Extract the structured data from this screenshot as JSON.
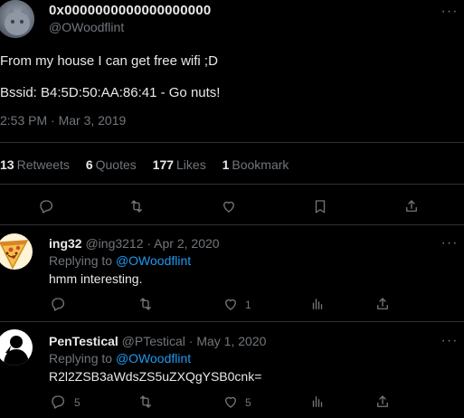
{
  "tweet": {
    "author": {
      "name": "0x0000000000000000000",
      "handle": "@OWoodflint",
      "avatar_icon": "gray-cat-avatar-icon"
    },
    "text_line1": "From my house I can get free wifi ;D",
    "text_line2": "Bssid: B4:5D:50:AA:86:41 - Go nuts!",
    "timestamp": "2:53 PM · Mar 3, 2019",
    "stats": {
      "retweets_count": "13",
      "retweets_label": "Retweets",
      "quotes_count": "6",
      "quotes_label": "Quotes",
      "likes_count": "177",
      "likes_label": "Likes",
      "bookmarks_count": "1",
      "bookmarks_label": "Bookmark"
    },
    "more_icon": "more-horizontal-icon"
  },
  "replies": [
    {
      "name": "ing32",
      "handle": "@ing3212",
      "date": "· Apr 2, 2020",
      "replying_prefix": "Replying to",
      "replying_handle": "@OWoodflint",
      "text": "hmm interesting.",
      "reply_count": "",
      "retweet_count": "",
      "like_count": "1",
      "avatar_icon": "pizza-avatar-icon"
    },
    {
      "name": "PenTestical",
      "handle": "@PTestical",
      "date": "· May 1, 2020",
      "replying_prefix": "Replying to",
      "replying_handle": "@OWoodflint",
      "text": "R2l2ZSB3aWdsZS5uZXQgYSB0cnk=",
      "reply_count": "5",
      "retweet_count": "",
      "like_count": "5",
      "avatar_icon": "silhouette-avatar-icon"
    }
  ],
  "colors": {
    "background": "#000000",
    "text": "#e7e9ea",
    "muted": "#71767b",
    "link": "#1d9bf0",
    "divider": "#2f3336"
  }
}
